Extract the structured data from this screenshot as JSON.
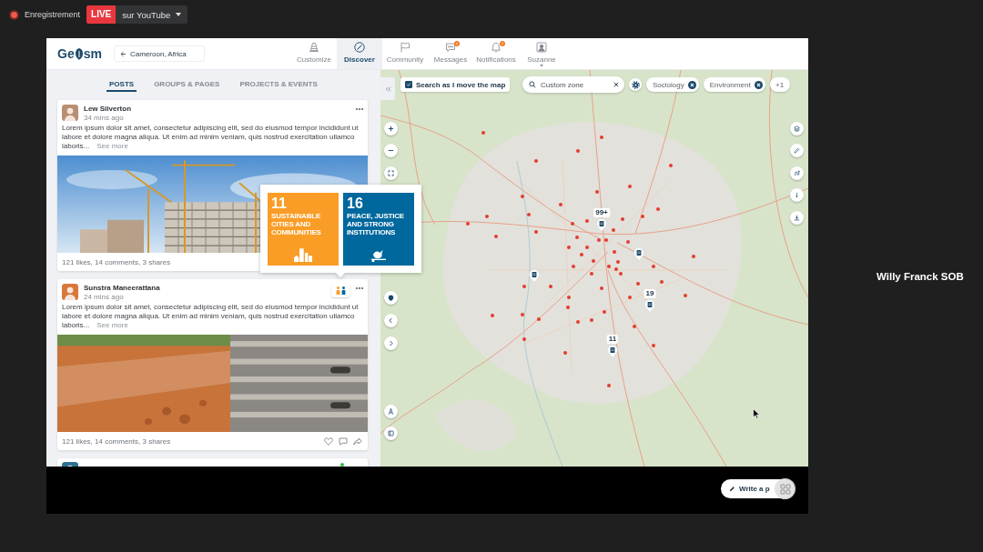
{
  "meeting": {
    "recording_label": "Enregistrement",
    "live_badge": "LIVE",
    "stream_target": "sur YouTube",
    "participant_name": "Willy Franck SOB"
  },
  "header": {
    "logo_start": "Ge",
    "logo_end": "sm",
    "location": "Cameroon, Africa",
    "nav": [
      {
        "label": "Customize",
        "selected": false,
        "badge": false,
        "menu": false
      },
      {
        "label": "Discover",
        "selected": true,
        "badge": false,
        "menu": false
      },
      {
        "label": "Community",
        "selected": false,
        "badge": false,
        "menu": false
      },
      {
        "label": "Messages",
        "selected": false,
        "badge": true,
        "menu": false
      },
      {
        "label": "Notifications",
        "selected": false,
        "badge": true,
        "menu": false
      },
      {
        "label": "Suzanne",
        "selected": false,
        "badge": false,
        "menu": true
      }
    ]
  },
  "feed": {
    "tabs": [
      {
        "label": "POSTS",
        "selected": true
      },
      {
        "label": "GROUPS & PAGES",
        "selected": false
      },
      {
        "label": "PROJECTS & EVENTS",
        "selected": false
      }
    ],
    "posts": [
      {
        "author": "Lew Silverton",
        "time": "34 mins ago",
        "text": "Lorem ipsum dolor sit amet, consectetur adipiscing elit, sed do eiusmod tempor incididunt ut labore et dolore magna aliqua. Ut enim ad minim veniam, quis nostrud exercitation ullamco laboris...",
        "see_more": "See more",
        "stats": "121 likes, 14 comments, 3 shares"
      },
      {
        "author": "Sunstra Maneerattana",
        "time": "24 mins ago",
        "text": "Lorem ipsum dolor sit amet, consectetur adipiscing elit, sed do eiusmod tempor incididunt ut labore et dolore magna aliqua. Ut enim ad minim veniam, quis nostrud exercitation ullamco laboris...",
        "see_more": "See more",
        "stats": "121 likes, 14 comments, 3 shares",
        "actions_shown": true,
        "sdg": {
          "open": true,
          "goals": [
            {
              "number": "11",
              "title": "SUSTAINABLE CITIES AND COMMUNITIES",
              "color": "#f99d26"
            },
            {
              "number": "16",
              "title": "PEACE, JUSTICE AND STRONG INSTITUTIONS",
              "color": "#00689d"
            }
          ]
        }
      }
    ],
    "partial_post": {
      "online": true
    }
  },
  "map": {
    "search_as_move": {
      "label": "Search as I move the map",
      "checked": true
    },
    "search": {
      "value": "Custom zone"
    },
    "filters": [
      {
        "label": "Sociology"
      },
      {
        "label": "Environment"
      }
    ],
    "more_filters": "+1",
    "clusters": [
      {
        "kind": "counted",
        "count": "99+"
      },
      {
        "kind": "single"
      },
      {
        "kind": "single"
      },
      {
        "kind": "counted",
        "count": "19"
      },
      {
        "kind": "counted",
        "count": "11"
      }
    ]
  },
  "compose": {
    "label": "Write a p"
  }
}
